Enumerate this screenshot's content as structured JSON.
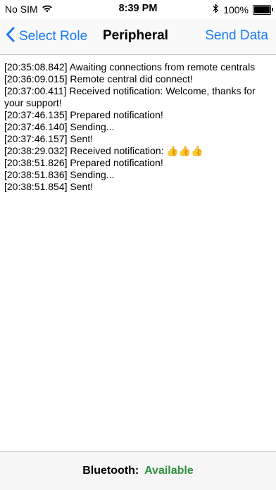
{
  "status_bar": {
    "carrier": "No SIM",
    "time": "8:39 PM",
    "battery_percent": "100%",
    "battery_level": 1.0
  },
  "nav": {
    "back_label": "Select Role",
    "title": "Peripheral",
    "action_label": "Send Data",
    "accent_color": "#1a7cf5"
  },
  "log": [
    "[20:35:08.842] Awaiting connections from remote centrals",
    "[20:36:09.015] Remote central did connect!",
    "[20:37:00.411] Received notification: Welcome, thanks for your support!",
    "[20:37:46.135] Prepared notification!",
    "[20:37:46.140] Sending...",
    "[20:37:46.157] Sent!",
    "[20:38:29.032] Received notification: 👍👍👍",
    "[20:38:51.826] Prepared notification!",
    "[20:38:51.836] Sending...",
    "[20:38:51.854] Sent!"
  ],
  "bottom_bar": {
    "label": "Bluetooth:",
    "status": "Available",
    "status_color": "#2f8f3a"
  }
}
